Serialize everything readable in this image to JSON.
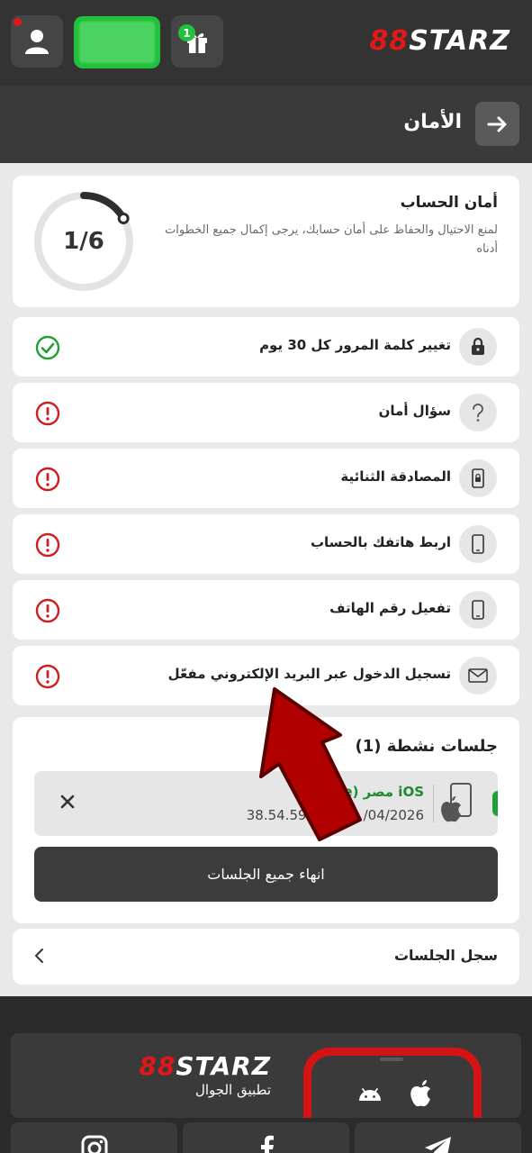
{
  "header": {
    "logo_mark": "88",
    "logo_text": "STARZ",
    "gift_count": "1"
  },
  "section": {
    "title": "الأمان"
  },
  "security": {
    "title": "أمان الحساب",
    "description": "لمنع الاحتيال والحفاظ على أمان حسابك، يرجى إكمال جميع الخطوات أدناه",
    "progress_label": "1/6",
    "progress_fraction": 0.1667
  },
  "items": [
    {
      "label": "تغيير كلمة المرور كل 30 يوم",
      "icon": "lock-icon",
      "status": "done"
    },
    {
      "label": "سؤال أمان",
      "icon": "question-icon",
      "status": "warning"
    },
    {
      "label": "المصادقة الثنائية",
      "icon": "phone-lock-icon",
      "status": "warning"
    },
    {
      "label": "اربط هاتفك بالحساب",
      "icon": "phone-icon",
      "status": "warning"
    },
    {
      "label": "تفعيل رقم الهاتف",
      "icon": "phone-icon",
      "status": "warning"
    },
    {
      "label": "تسجيل الدخول عبر البريد الإلكتروني مفعّل",
      "icon": "envelope-icon",
      "status": "warning"
    }
  ],
  "sessions": {
    "title": "جلسات نشطة (1)",
    "row": {
      "os": "iOS مصر (e",
      "info": "38.54.59.53 ,(20 /04/2026"
    },
    "end_all_label": "انهاء جميع الجلسات"
  },
  "history": {
    "label": "سجل الجلسات"
  },
  "footer": {
    "logo_mark": "88",
    "logo_text": "STARZ",
    "subtitle": "تطبيق الجوال"
  },
  "colors": {
    "accent_red": "#e01818",
    "success_green": "#22a035",
    "warning_red": "#cc1f1f"
  }
}
